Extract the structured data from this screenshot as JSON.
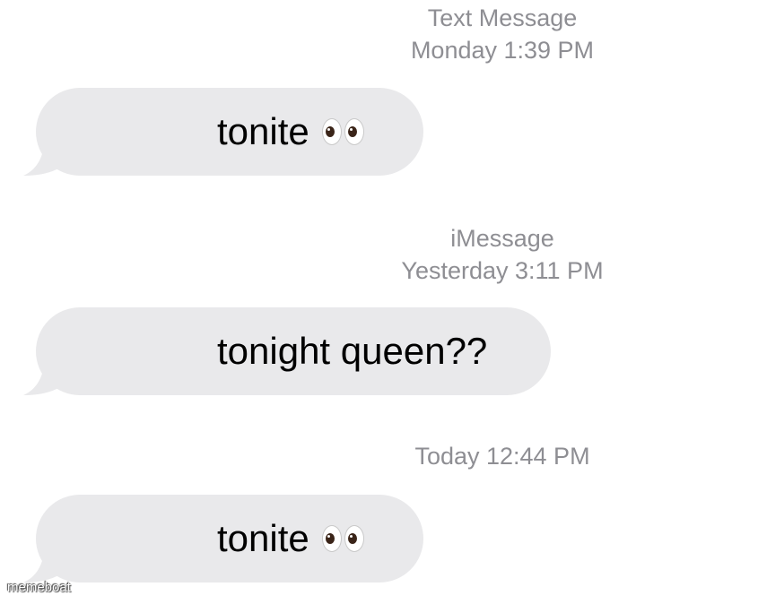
{
  "conversation": {
    "groups": [
      {
        "service": "Text Message",
        "timestamp": "Monday 1:39 PM",
        "message": {
          "text": "tonite",
          "emoji": "eyes-emoji"
        }
      },
      {
        "service": "iMessage",
        "timestamp": "Yesterday 3:11 PM",
        "message": {
          "text": "tonight queen??"
        }
      },
      {
        "timestamp": "Today 12:44 PM",
        "message": {
          "text": "tonite",
          "emoji": "eyes-emoji"
        }
      }
    ]
  },
  "colors": {
    "bubble_background": "#e9e9eb",
    "meta_text": "#8e8e93",
    "message_text": "#000000"
  },
  "watermark": "memeboat"
}
